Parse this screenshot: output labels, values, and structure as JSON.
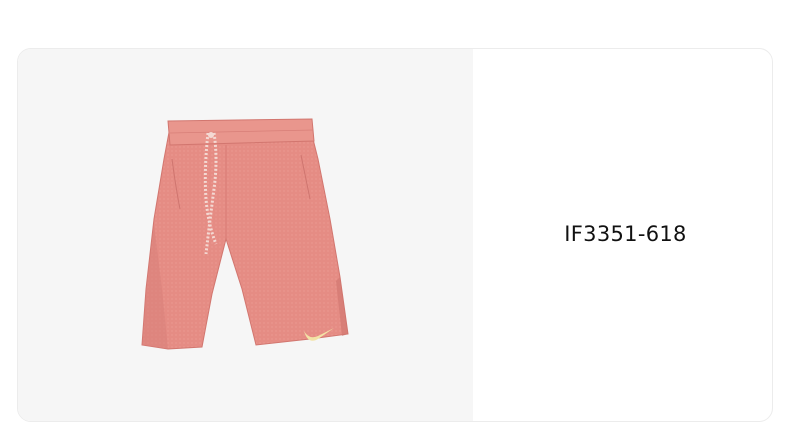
{
  "product": {
    "code": "IF3351-618",
    "image_icon": "shorts-product-image",
    "colors": {
      "shorts": "#e58c84",
      "shorts_shadow": "#d2766f",
      "waistband": "#e9968d",
      "drawcord": "#f4d9d3",
      "logo": "#f3e3a6",
      "image_background": "#f6f6f6"
    }
  }
}
